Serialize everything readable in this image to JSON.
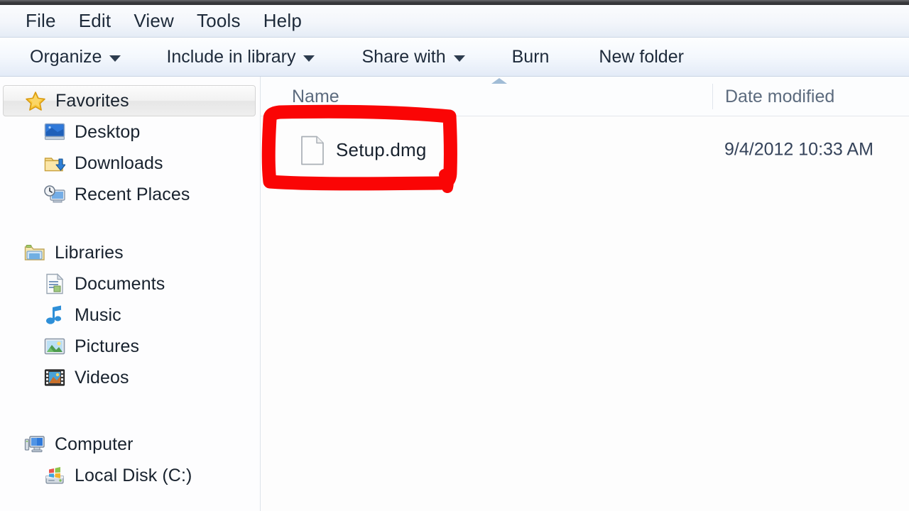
{
  "window": {
    "app": "Windows Explorer"
  },
  "menubar": {
    "items": [
      {
        "label": "File"
      },
      {
        "label": "Edit"
      },
      {
        "label": "View"
      },
      {
        "label": "Tools"
      },
      {
        "label": "Help"
      }
    ]
  },
  "toolbar": {
    "buttons": [
      {
        "label": "Organize",
        "has_caret": true
      },
      {
        "label": "Include in library",
        "has_caret": true
      },
      {
        "label": "Share with",
        "has_caret": true
      },
      {
        "label": "Burn",
        "has_caret": false
      },
      {
        "label": "New folder",
        "has_caret": false
      }
    ]
  },
  "navpane": {
    "groups": [
      {
        "header": {
          "label": "Favorites",
          "icon": "star-icon",
          "selected": true
        },
        "items": [
          {
            "label": "Desktop",
            "icon": "desktop-icon"
          },
          {
            "label": "Downloads",
            "icon": "downloads-folder-icon"
          },
          {
            "label": "Recent Places",
            "icon": "recent-places-icon"
          }
        ]
      },
      {
        "header": {
          "label": "Libraries",
          "icon": "libraries-icon",
          "selected": false
        },
        "items": [
          {
            "label": "Documents",
            "icon": "documents-library-icon"
          },
          {
            "label": "Music",
            "icon": "music-note-icon"
          },
          {
            "label": "Pictures",
            "icon": "pictures-icon"
          },
          {
            "label": "Videos",
            "icon": "videos-filmstrip-icon"
          }
        ]
      },
      {
        "header": {
          "label": "Computer",
          "icon": "computer-icon",
          "selected": false
        },
        "items": [
          {
            "label": "Local Disk (C:)",
            "icon": "hard-disk-icon"
          }
        ]
      }
    ]
  },
  "filelist": {
    "columns": {
      "name": "Name",
      "date_modified": "Date modified"
    },
    "sort": {
      "column": "Name",
      "direction": "ascending"
    },
    "rows": [
      {
        "name": "Setup.dmg",
        "date_modified": "9/4/2012 10:33 AM",
        "icon": "generic-file-icon",
        "highlighted": true
      }
    ]
  },
  "annotation": {
    "shape": "hand-drawn-rectangle",
    "color": "#FA0505",
    "target": "Setup.dmg"
  }
}
